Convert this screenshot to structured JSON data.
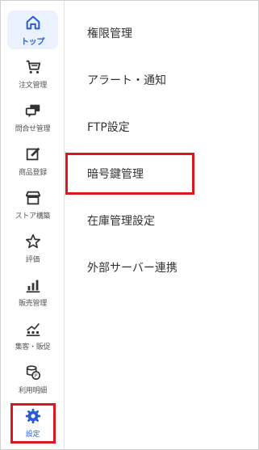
{
  "sidebar": {
    "items": [
      {
        "label": "トップ",
        "icon": "home-icon"
      },
      {
        "label": "注文管理",
        "icon": "cart-icon"
      },
      {
        "label": "問合せ管理",
        "icon": "chat-icon"
      },
      {
        "label": "商品登録",
        "icon": "edit-icon"
      },
      {
        "label": "ストア構築",
        "icon": "store-icon"
      },
      {
        "label": "評価",
        "icon": "star-icon"
      },
      {
        "label": "販売管理",
        "icon": "bar-chart-icon"
      },
      {
        "label": "集客・販促",
        "icon": "promotion-icon"
      },
      {
        "label": "利用明細",
        "icon": "coins-icon"
      },
      {
        "label": "設定",
        "icon": "gear-icon"
      }
    ],
    "active_index": 0,
    "highlighted_index": 9
  },
  "menu": {
    "items": [
      {
        "label": "権限管理"
      },
      {
        "label": "アラート・通知"
      },
      {
        "label": "FTP設定"
      },
      {
        "label": "暗号鍵管理"
      },
      {
        "label": "在庫管理設定"
      },
      {
        "label": "外部サーバー連携"
      }
    ],
    "highlighted_index": 3
  },
  "colors": {
    "accent": "#2a5bd7",
    "active_bg": "#eaf1ff",
    "highlight_border": "#d9191d",
    "icon": "#333333"
  }
}
